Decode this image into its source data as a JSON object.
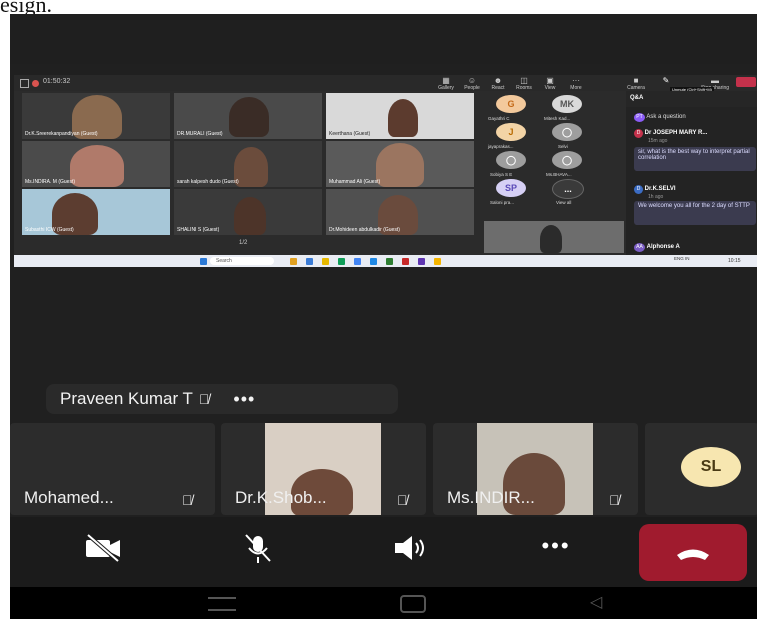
{
  "page_caption": "esign.",
  "meeting": {
    "timer": "01:50:32",
    "toolbar": [
      {
        "label": "Gallery",
        "icon": "grid-icon"
      },
      {
        "label": "People",
        "icon": "people-icon"
      },
      {
        "label": "React",
        "icon": "react-icon"
      },
      {
        "label": "Rooms",
        "icon": "rooms-icon"
      },
      {
        "label": "View",
        "icon": "view-icon"
      },
      {
        "label": "More",
        "icon": "more-icon"
      }
    ],
    "camera_label": "Camera",
    "stop_sharing_label": "Stop sharing",
    "unmute_hint": "Unmute (Ctrl+Shift+M)"
  },
  "shared_tiles": [
    "Dr.K.Sreerekanpandiyan (Guest)",
    "DR.MURALI (Guest)",
    "Keerthana (Guest)",
    "Ms.INDIRA. M (Guest)",
    "sarah kalpesh dudo (Guest)",
    "Muhammad Ali (Guest)",
    "Subasthi ICW (Guest)",
    "SHALINI S (Guest)",
    "Dr.Mohideen abdulkadir (Guest)"
  ],
  "page_indicator": "1/2",
  "avatars": [
    {
      "initials": "G",
      "name": "Gayathri C",
      "color": "#f3c99c"
    },
    {
      "initials": "MK",
      "name": "Mitesh Kad...",
      "color": "#d9d9d9"
    },
    {
      "initials": "J",
      "name": "jayaprakas...",
      "color": "#f3d4a6"
    },
    {
      "initials": "",
      "name": "Selvi",
      "color": "#9e9e9e"
    },
    {
      "initials": "",
      "name": "Sobiya S E",
      "color": "#9e9e9e"
    },
    {
      "initials": "",
      "name": "Ms.BHAVA...",
      "color": "#9e9e9e"
    },
    {
      "initials": "SP",
      "name": "Saloni pra...",
      "color": "#d6d0f5"
    },
    {
      "initials": "...",
      "name": "View all",
      "color": "#3a3a3a"
    }
  ],
  "qa": {
    "title": "Q&A",
    "ask": "Ask a question",
    "ask_avatar": "PT",
    "items": [
      {
        "avatar": "D",
        "name": "Dr JOSEPH MARY R...",
        "time": "15m ago",
        "text": "sir, what is the best way to interpret partial correlation"
      },
      {
        "avatar": "D",
        "name": "Dr.K.SELVI",
        "time": "1h ago",
        "text": "We welcome you all for the 2 day of STTP"
      },
      {
        "avatar": "AA",
        "name": "Alphonse A",
        "time": "",
        "text": ""
      }
    ]
  },
  "pc_taskbar": {
    "search": "Search",
    "tray_lang": "ENG IN",
    "tray_time": "10:15"
  },
  "speaker_bar": {
    "name": "Praveen Kumar T",
    "more": "•••"
  },
  "participants": [
    {
      "name": "Mohamed...",
      "has_video": false
    },
    {
      "name": "Dr.K.Shob...",
      "has_video": true
    },
    {
      "name": "Ms.INDIR...",
      "has_video": true
    },
    {
      "name": "SL",
      "has_video": false
    }
  ],
  "controls": {
    "camera_icon": "camera-off-icon",
    "mic_icon": "mic-off-icon",
    "speaker_icon": "speaker-icon",
    "more_label": "•••",
    "hangup_icon": "hang-up-icon",
    "hangup_color": "#a01b2e"
  }
}
